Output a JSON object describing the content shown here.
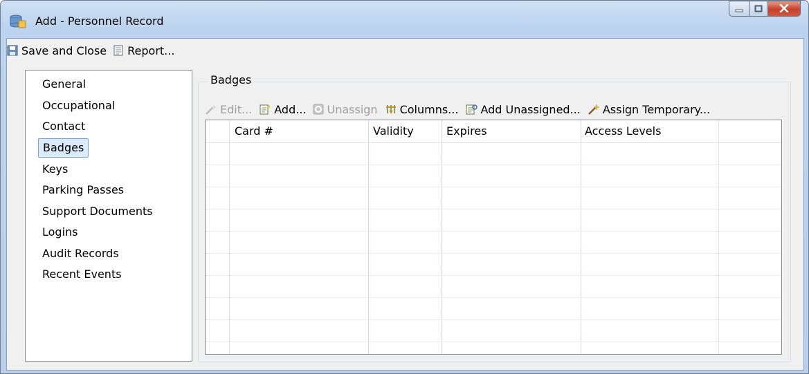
{
  "window": {
    "title": "Add - Personnel Record"
  },
  "toolbar": {
    "save_close_label": "Save and Close",
    "report_label": "Report..."
  },
  "nav": {
    "items": [
      {
        "label": "General"
      },
      {
        "label": "Occupational"
      },
      {
        "label": "Contact"
      },
      {
        "label": "Badges",
        "selected": true
      },
      {
        "label": "Keys"
      },
      {
        "label": "Parking Passes"
      },
      {
        "label": "Support Documents"
      },
      {
        "label": "Logins"
      },
      {
        "label": "Audit Records"
      },
      {
        "label": "Recent Events"
      }
    ]
  },
  "badges": {
    "group_title": "Badges",
    "toolbar": {
      "edit_label": "Edit...",
      "add_label": "Add...",
      "unassign_label": "Unassign",
      "columns_label": "Columns...",
      "add_unassigned_label": "Add Unassigned...",
      "assign_temporary_label": "Assign Temporary..."
    },
    "columns": [
      "Card #",
      "Validity",
      "Expires",
      "Access Levels"
    ],
    "rows": []
  },
  "colors": {
    "title_gradient": "#cfe0f3",
    "selection_bg": "#dcebfc",
    "selection_border": "#7da2ce",
    "close_red": "#c7412b"
  }
}
